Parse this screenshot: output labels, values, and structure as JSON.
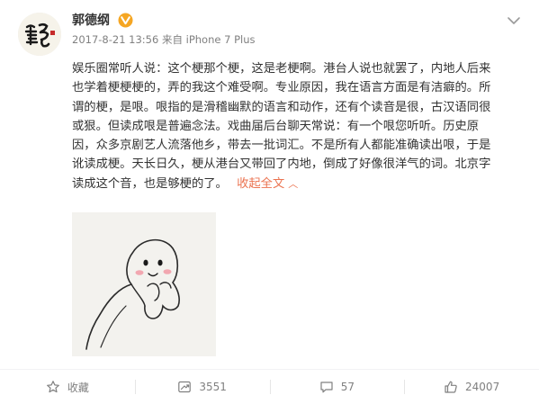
{
  "post": {
    "author": "郭德纲",
    "timestamp": "2017-8-21 13:56",
    "source_prefix": "来自",
    "device": "iPhone 7 Plus",
    "text_lines": [
      "娱乐圈常听人说：这个梗那个梗，这是老梗啊。港台人说也就罢了，内地人后来",
      "也学着梗梗梗的，弄的我这个难受啊。专业原因，我在语言方面是有洁癖的。所",
      "谓的梗，是哏。哏指的是滑稽幽默的语言和动作，还有个读音是很，古汉语同很",
      "或狠。但读成哏是普遍念法。戏曲届后台聊天常说：有一个哏您听听。历史原",
      "因，众多京剧艺人流落他乡，带去一批词汇。不是所有人都能准确读出哏，于是",
      "讹读成梗。天长日久，梗从港台又带回了内地，倒成了好像很洋气的词。北京字",
      "读成这个音，也是够梗的了。"
    ],
    "collapse_label": "收起全文",
    "collapse_arrow": "︿"
  },
  "actions": {
    "favorite_label": "收藏",
    "repost_count": "3551",
    "comment_count": "57",
    "like_count": "24007"
  },
  "colors": {
    "accent": "#eb7350",
    "vip_badge": "#f5a623",
    "meta_text": "#808080",
    "body_text": "#333333"
  },
  "icons": {
    "avatar": "calligraphy-avatar",
    "badge": "verified-v-icon",
    "menu": "chevron-down-icon",
    "favorite": "star-icon",
    "repost": "repost-icon",
    "comment": "comment-icon",
    "like": "thumbs-up-icon"
  }
}
